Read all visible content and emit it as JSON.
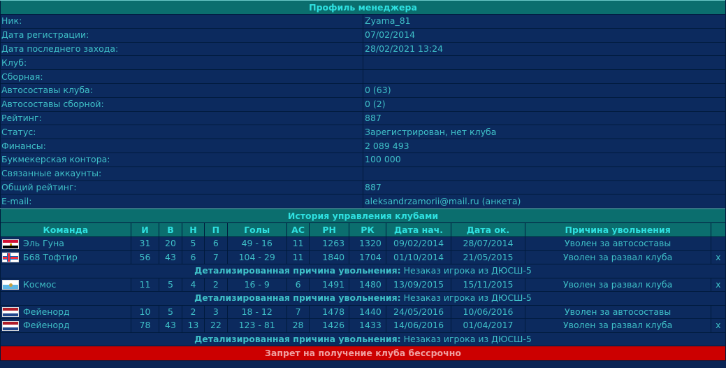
{
  "profile": {
    "header": "Профиль менеджера",
    "rows": [
      {
        "label": "Ник:",
        "value": "Zyama_81"
      },
      {
        "label": "Дата регистрации:",
        "value": "07/02/2014"
      },
      {
        "label": "Дата последнего захода:",
        "value": "28/02/2021 13:24"
      },
      {
        "label": "Клуб:",
        "value": ""
      },
      {
        "label": "Сборная:",
        "value": ""
      },
      {
        "label": "Автосоставы клуба:",
        "value": "0 (63)"
      },
      {
        "label": "Автосоставы сборной:",
        "value": "0 (2)"
      },
      {
        "label": "Рейтинг:",
        "value": "887"
      },
      {
        "label": "Статус:",
        "value": "Зарегистрирован, нет клуба"
      },
      {
        "label": "Финансы:",
        "value": "2 089 493"
      },
      {
        "label": "Букмекерская контора:",
        "value": "100 000"
      },
      {
        "label": "Связанные аккаунты:",
        "value": ""
      },
      {
        "label": "Общий рейтинг:",
        "value": "887"
      },
      {
        "label": "E-mail:",
        "value": "aleksandrzamorii@mail.ru (анкета)"
      }
    ]
  },
  "history": {
    "header": "История управления клубами",
    "columns": [
      "Команда",
      "И",
      "В",
      "Н",
      "П",
      "Голы",
      "АС",
      "РН",
      "РК",
      "Дата нач.",
      "Дата ок.",
      "Причина увольнения",
      ""
    ],
    "detail_label": "Детализированная причина увольнения:",
    "detail_text": "Незаказ игрока из ДЮСШ-5",
    "rows": [
      {
        "flag": "egypt-flag-icon",
        "team": "Эль Гуна",
        "i": "31",
        "w": "20",
        "d": "5",
        "l": "6",
        "goals": "49 - 16",
        "as": "11",
        "rn": "1263",
        "rk": "1320",
        "start": "09/02/2014",
        "end": "28/07/2014",
        "reason": "Уволен за автосоставы",
        "x": "",
        "detail": false
      },
      {
        "flag": "faroe-flag-icon",
        "team": "Б68 Тофтир",
        "i": "56",
        "w": "43",
        "d": "6",
        "l": "7",
        "goals": "104 - 29",
        "as": "11",
        "rn": "1840",
        "rk": "1704",
        "start": "01/10/2014",
        "end": "21/05/2015",
        "reason": "Уволен за развал клуба",
        "x": "x",
        "detail": true
      },
      {
        "flag": "sanmarino-flag-icon",
        "team": "Космос",
        "i": "11",
        "w": "5",
        "d": "4",
        "l": "2",
        "goals": "16 - 9",
        "as": "6",
        "rn": "1491",
        "rk": "1480",
        "start": "13/09/2015",
        "end": "15/11/2015",
        "reason": "Уволен за развал клуба",
        "x": "x",
        "detail": true
      },
      {
        "flag": "netherlands-flag-icon",
        "team": "Фейенорд",
        "i": "10",
        "w": "5",
        "d": "2",
        "l": "3",
        "goals": "18 - 12",
        "as": "7",
        "rn": "1478",
        "rk": "1440",
        "start": "24/05/2016",
        "end": "10/06/2016",
        "reason": "Уволен за автосоставы",
        "x": "",
        "detail": false
      },
      {
        "flag": "netherlands-flag-icon",
        "team": "Фейенорд",
        "i": "78",
        "w": "43",
        "d": "13",
        "l": "22",
        "goals": "123 - 81",
        "as": "28",
        "rn": "1426",
        "rk": "1433",
        "start": "14/06/2016",
        "end": "01/04/2017",
        "reason": "Уволен за развал клуба",
        "x": "x",
        "detail": true
      }
    ]
  },
  "ban": {
    "text": "Запрет на получение клуба бессрочно"
  }
}
